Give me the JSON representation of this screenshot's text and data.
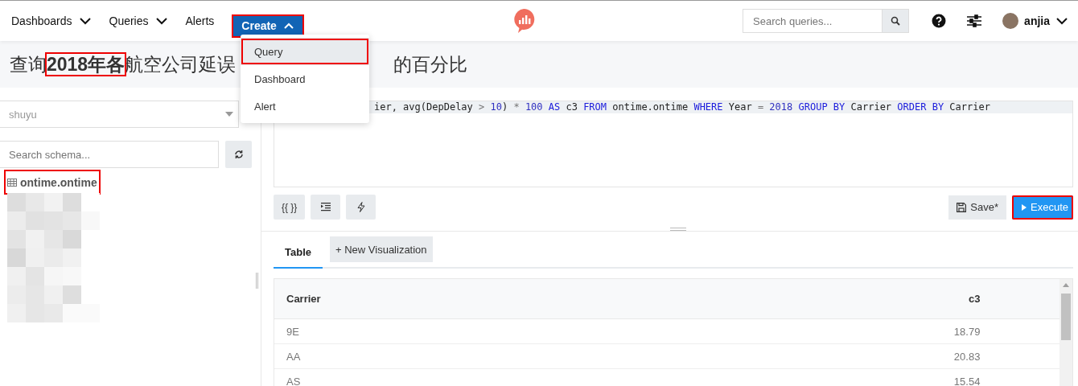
{
  "nav": {
    "items": [
      {
        "label": "Dashboards",
        "kind": "dropdown"
      },
      {
        "label": "Queries",
        "kind": "dropdown"
      },
      {
        "label": "Alerts",
        "kind": "link"
      }
    ],
    "create": {
      "label": "Create",
      "expanded": true,
      "highlighted": true
    },
    "create_menu": [
      {
        "label": "Query",
        "selected": true,
        "highlighted": true
      },
      {
        "label": "Dashboard",
        "selected": false,
        "highlighted": false
      },
      {
        "label": "Alert",
        "selected": false,
        "highlighted": false
      }
    ],
    "search": {
      "placeholder": "Search queries..."
    },
    "user": {
      "name": "anjia"
    }
  },
  "title": {
    "parts": [
      {
        "text": "查询",
        "highlighted": false
      },
      {
        "text": "2018年各",
        "highlighted": true
      },
      {
        "text": "航空公司延误",
        "highlighted": false
      }
    ],
    "tail": "的百分比"
  },
  "schema": {
    "data_source": "shuyu",
    "search_placeholder": "Search schema...",
    "tables": [
      {
        "name": "ontime.ontime",
        "highlighted": true
      }
    ]
  },
  "editor": {
    "tokens": [
      {
        "text": "ier, avg(DepDelay ",
        "kind": "plain"
      },
      {
        "text": ">",
        "kind": "operator"
      },
      {
        "text": " 10",
        "kind": "number"
      },
      {
        "text": ") ",
        "kind": "plain"
      },
      {
        "text": "*",
        "kind": "operator"
      },
      {
        "text": " 100 ",
        "kind": "number"
      },
      {
        "text": "AS",
        "kind": "keyword"
      },
      {
        "text": " c3 ",
        "kind": "plain"
      },
      {
        "text": "FROM",
        "kind": "keyword"
      },
      {
        "text": " ontime.ontime ",
        "kind": "plain"
      },
      {
        "text": "WHERE",
        "kind": "keyword"
      },
      {
        "text": " Year ",
        "kind": "plain"
      },
      {
        "text": "=",
        "kind": "operator"
      },
      {
        "text": " 2018 ",
        "kind": "number"
      },
      {
        "text": "GROUP BY",
        "kind": "keyword"
      },
      {
        "text": " Carrier ",
        "kind": "plain"
      },
      {
        "text": "ORDER BY",
        "kind": "keyword"
      },
      {
        "text": " Carrier",
        "kind": "plain"
      }
    ],
    "tool_buttons": [
      {
        "label": "{{ }}",
        "kind": "text"
      },
      {
        "kind": "indent"
      },
      {
        "kind": "bolt"
      }
    ],
    "save": {
      "label": "Save*"
    },
    "execute": {
      "label": "Execute",
      "highlighted": true
    }
  },
  "results": {
    "tabs": [
      {
        "label": "Table",
        "selected": true,
        "kind": "tab"
      },
      {
        "label": "+ New Visualization",
        "selected": false,
        "kind": "add"
      }
    ],
    "table": {
      "columns": [
        "Carrier",
        "c3"
      ],
      "rows": [
        [
          "9E",
          "18.79"
        ],
        [
          "AA",
          "20.83"
        ],
        [
          "AS",
          "15.54"
        ]
      ]
    }
  }
}
